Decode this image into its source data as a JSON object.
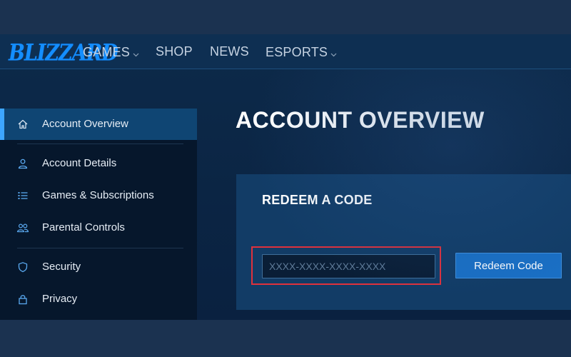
{
  "brand": {
    "logo_text": "BLIZZARD",
    "accent_color": "#148eff"
  },
  "topnav": {
    "items": [
      {
        "label": "GAMES",
        "has_dropdown": true,
        "icon": "chevron-down-icon"
      },
      {
        "label": "SHOP",
        "has_dropdown": false
      },
      {
        "label": "NEWS",
        "has_dropdown": false
      },
      {
        "label": "ESPORTS",
        "has_dropdown": true,
        "icon": "chevron-down-icon"
      }
    ]
  },
  "sidebar": {
    "items": [
      {
        "label": "Account Overview",
        "icon": "home-icon",
        "active": true
      },
      {
        "label": "Account Details",
        "icon": "user-icon"
      },
      {
        "label": "Games & Subscriptions",
        "icon": "list-icon"
      },
      {
        "label": "Parental Controls",
        "icon": "users-icon"
      },
      {
        "label": "Security",
        "icon": "shield-icon"
      },
      {
        "label": "Privacy",
        "icon": "lock-icon"
      }
    ]
  },
  "main": {
    "title": "ACCOUNT OVERVIEW",
    "redeem": {
      "heading": "REDEEM A CODE",
      "input_placeholder": "XXXX-XXXX-XXXX-XXXX",
      "input_value": "",
      "button_label": "Redeem Code",
      "highlight_color": "#e0313c"
    }
  }
}
